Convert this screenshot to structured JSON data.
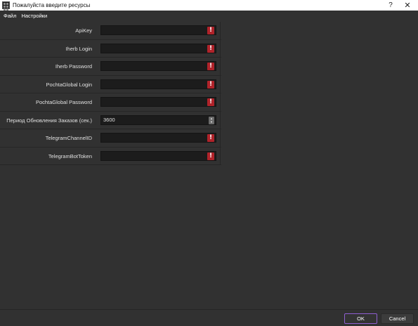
{
  "window": {
    "title": "Пожалуйста введите ресурсы",
    "help_glyph": "?",
    "close_glyph": "✕"
  },
  "menu": {
    "items": [
      "Файл",
      "Настройки"
    ]
  },
  "form": {
    "rows": [
      {
        "label": "ApiKey",
        "value": "",
        "indicator": "warning"
      },
      {
        "label": "Iherb Login",
        "value": "",
        "indicator": "warning"
      },
      {
        "label": "Iherb Password",
        "value": "",
        "indicator": "warning"
      },
      {
        "label": "PochtaGlobal Login",
        "value": "",
        "indicator": "warning"
      },
      {
        "label": "PochtaGlobal Password",
        "value": "",
        "indicator": "warning"
      },
      {
        "label": "Период Обновления Заказов (сек.)",
        "value": "3600",
        "indicator": "spinbox"
      },
      {
        "label": "TelegramChannelID",
        "value": "",
        "indicator": "warning"
      },
      {
        "label": "TelegramBotToken",
        "value": "",
        "indicator": "warning"
      }
    ]
  },
  "buttons": {
    "ok": "OK",
    "cancel": "Cancel"
  },
  "colors": {
    "background": "#313131",
    "field": "#1c1c1c",
    "warning": "#b0232a",
    "accent": "#8f5fd0"
  }
}
